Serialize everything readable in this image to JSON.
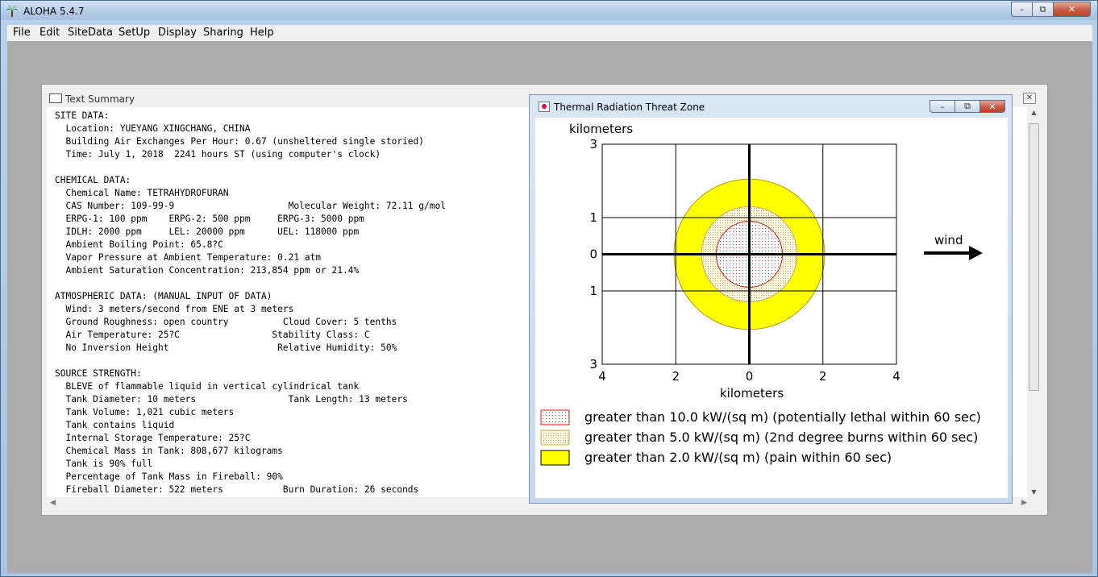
{
  "app": {
    "title": "ALOHA 5.4.7",
    "menu": [
      "File",
      "Edit",
      "SiteData",
      "SetUp",
      "Display",
      "Sharing",
      "Help"
    ]
  },
  "summary_window": {
    "title": "Text Summary",
    "lines": [
      "SITE DATA:",
      "  Location: YUEYANG XINGCHANG, CHINA",
      "  Building Air Exchanges Per Hour: 0.67 (unsheltered single storied)",
      "  Time: July 1, 2018  2241 hours ST (using computer's clock)",
      "",
      "CHEMICAL DATA:",
      "  Chemical Name: TETRAHYDROFURAN",
      "  CAS Number: 109-99-9                     Molecular Weight: 72.11 g/mol",
      "  ERPG-1: 100 ppm    ERPG-2: 500 ppm     ERPG-3: 5000 ppm",
      "  IDLH: 2000 ppm     LEL: 20000 ppm      UEL: 118000 ppm",
      "  Ambient Boiling Point: 65.8?C",
      "  Vapor Pressure at Ambient Temperature: 0.21 atm",
      "  Ambient Saturation Concentration: 213,854 ppm or 21.4%",
      "",
      "ATMOSPHERIC DATA: (MANUAL INPUT OF DATA)",
      "  Wind: 3 meters/second from ENE at 3 meters",
      "  Ground Roughness: open country          Cloud Cover: 5 tenths",
      "  Air Temperature: 25?C                 Stability Class: C",
      "  No Inversion Height                    Relative Humidity: 50%",
      "",
      "SOURCE STRENGTH:",
      "  BLEVE of flammable liquid in vertical cylindrical tank",
      "  Tank Diameter: 10 meters                 Tank Length: 13 meters",
      "  Tank Volume: 1,021 cubic meters",
      "  Tank contains liquid",
      "  Internal Storage Temperature: 25?C",
      "  Chemical Mass in Tank: 808,677 kilograms",
      "  Tank is 90% full",
      "  Percentage of Tank Mass in Fireball: 90%",
      "  Fireball Diameter: 522 meters           Burn Duration: 26 seconds"
    ]
  },
  "threat_window": {
    "title": "Thermal Radiation Threat Zone",
    "ylabel": "kilometers",
    "xlabel": "kilometers",
    "wind_label": "wind",
    "x_ticks": [
      "4",
      "2",
      "0",
      "2",
      "4"
    ],
    "y_ticks_top": "3",
    "y_ticks": [
      "1",
      "0",
      "1"
    ],
    "y_ticks_bottom": "3",
    "legend": [
      {
        "label": "greater than 10.0 kW/(sq m) (potentially lethal within 60 sec)",
        "color": "#ff4040"
      },
      {
        "label": "greater than 5.0 kW/(sq m) (2nd degree burns within 60 sec)",
        "color": "#e8c890"
      },
      {
        "label": "greater than 2.0 kW/(sq m) (pain within 60 sec)",
        "color": "#ffff00"
      }
    ]
  },
  "chart_data": {
    "type": "area",
    "xlabel": "kilometers",
    "ylabel": "kilometers",
    "xlim": [
      -4,
      4
    ],
    "ylim": [
      -3,
      3
    ],
    "grid": true,
    "zones": [
      {
        "name": "greater than 10.0 kW/(sq m) (potentially lethal within 60 sec)",
        "radius_km": 0.9,
        "color": "#ff4040"
      },
      {
        "name": "greater than 5.0 kW/(sq m) (2nd degree burns within 60 sec)",
        "radius_km": 1.3,
        "color": "#e8c890"
      },
      {
        "name": "greater than 2.0 kW/(sq m) (pain within 60 sec)",
        "radius_km": 2.05,
        "color": "#ffff00"
      }
    ]
  }
}
